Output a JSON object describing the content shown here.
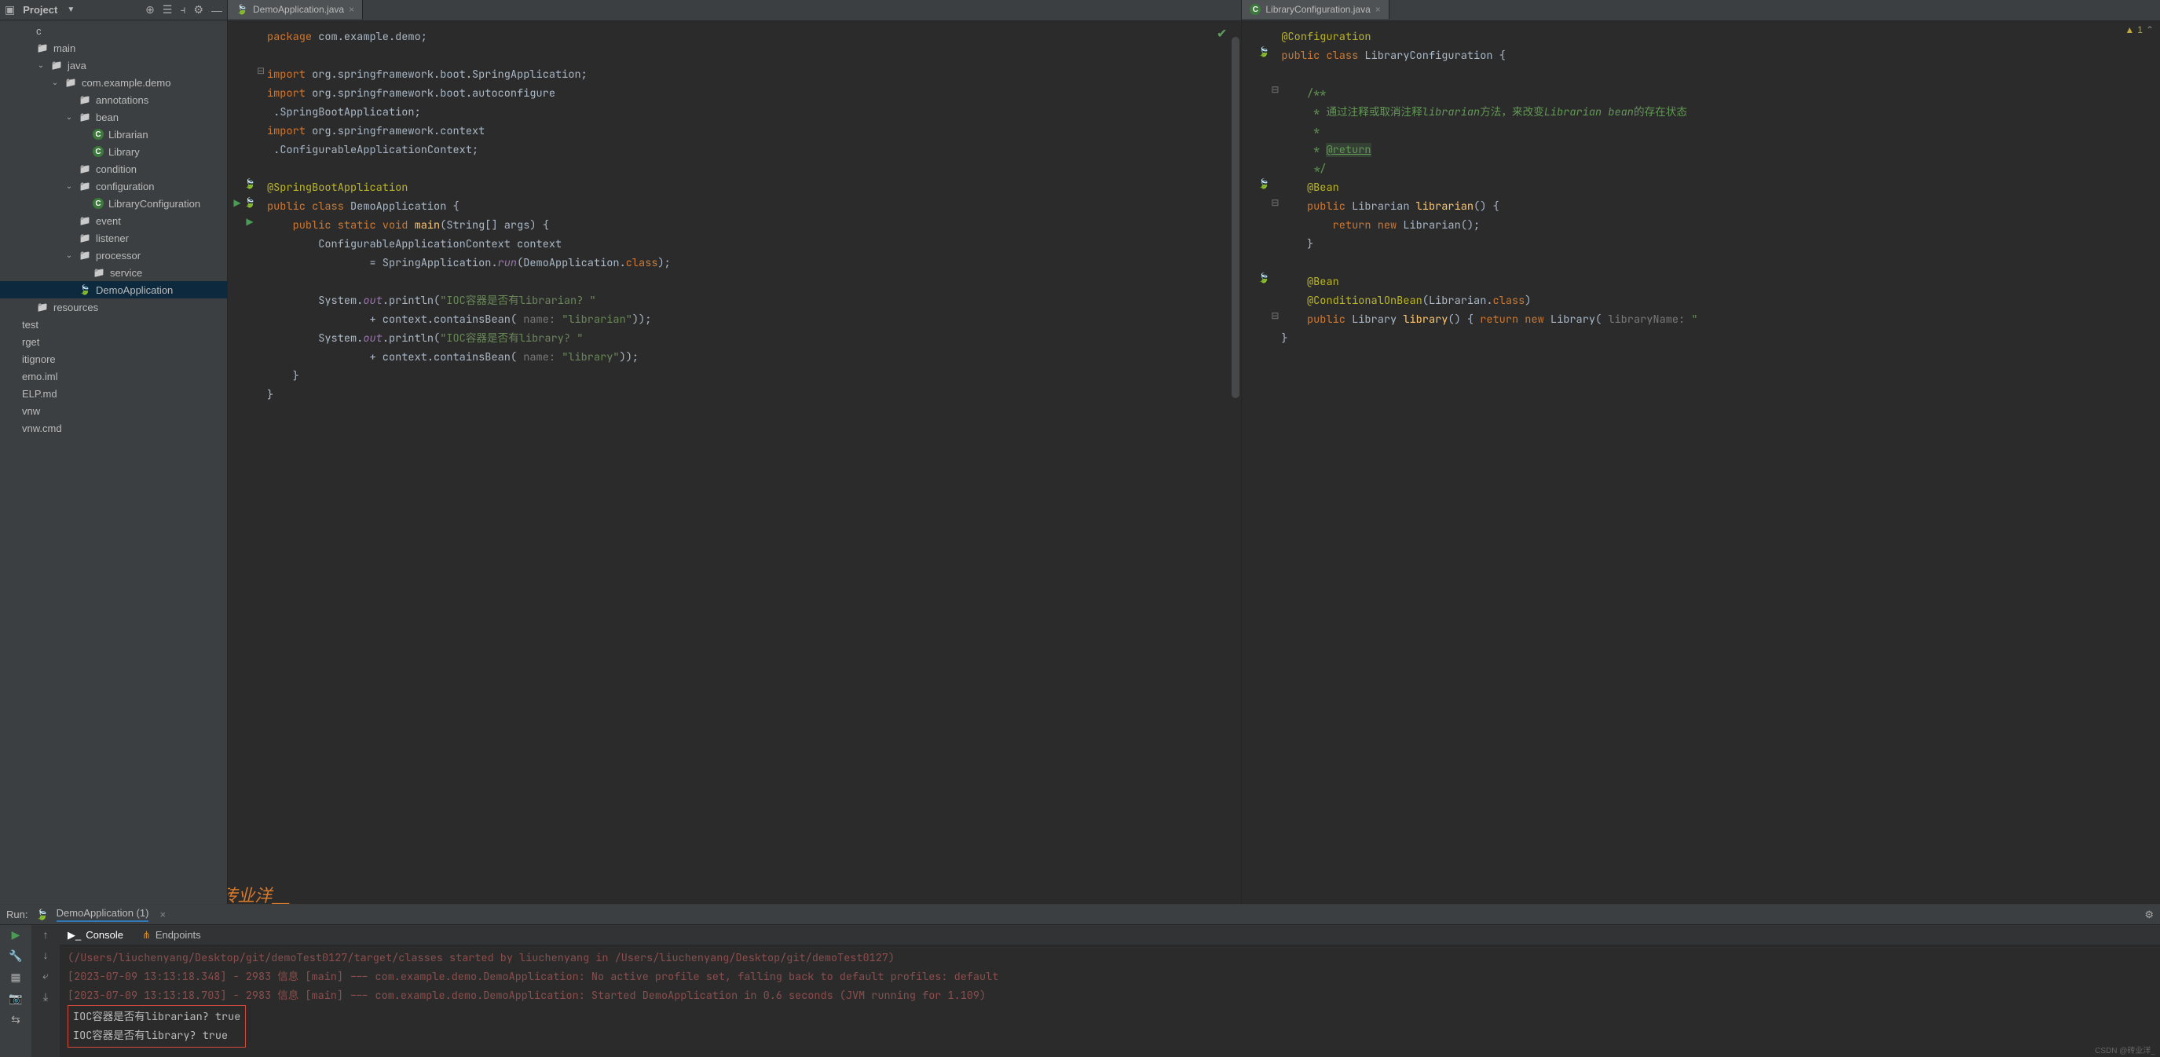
{
  "sidebar": {
    "dropdown_label": "Project",
    "tree": [
      {
        "depth": 0,
        "arrow": "",
        "icon": "",
        "label": "c"
      },
      {
        "depth": 0,
        "arrow": "",
        "icon": "folder",
        "label": "main"
      },
      {
        "depth": 1,
        "arrow": "down",
        "icon": "folder",
        "label": "java",
        "java": true
      },
      {
        "depth": 2,
        "arrow": "down",
        "icon": "pkg",
        "label": "com.example.demo"
      },
      {
        "depth": 3,
        "arrow": "",
        "icon": "pkg",
        "label": "annotations"
      },
      {
        "depth": 3,
        "arrow": "down",
        "icon": "pkg",
        "label": "bean"
      },
      {
        "depth": 4,
        "arrow": "",
        "icon": "class",
        "label": "Librarian"
      },
      {
        "depth": 4,
        "arrow": "",
        "icon": "class",
        "label": "Library"
      },
      {
        "depth": 3,
        "arrow": "",
        "icon": "pkg",
        "label": "condition"
      },
      {
        "depth": 3,
        "arrow": "down",
        "icon": "pkg",
        "label": "configuration"
      },
      {
        "depth": 4,
        "arrow": "",
        "icon": "class",
        "label": "LibraryConfiguration"
      },
      {
        "depth": 3,
        "arrow": "",
        "icon": "pkg",
        "label": "event"
      },
      {
        "depth": 3,
        "arrow": "",
        "icon": "pkg",
        "label": "listener"
      },
      {
        "depth": 3,
        "arrow": "down",
        "icon": "pkg",
        "label": "processor"
      },
      {
        "depth": 4,
        "arrow": "",
        "icon": "pkg",
        "label": "service"
      },
      {
        "depth": 3,
        "arrow": "",
        "icon": "spring",
        "label": "DemoApplication",
        "selected": true
      },
      {
        "depth": 0,
        "arrow": "",
        "icon": "folder",
        "label": "resources"
      },
      {
        "depth": -1,
        "arrow": "",
        "icon": "",
        "label": "test"
      },
      {
        "depth": -1,
        "arrow": "",
        "icon": "",
        "label": "rget"
      },
      {
        "depth": -1,
        "arrow": "",
        "icon": "",
        "label": "itignore"
      },
      {
        "depth": -1,
        "arrow": "",
        "icon": "",
        "label": "emo.iml"
      },
      {
        "depth": -1,
        "arrow": "",
        "icon": "",
        "label": "ELP.md"
      },
      {
        "depth": -1,
        "arrow": "",
        "icon": "",
        "label": "vnw"
      },
      {
        "depth": -1,
        "arrow": "",
        "icon": "",
        "label": "vnw.cmd"
      }
    ]
  },
  "editor1": {
    "tab_label": "DemoApplication.java",
    "code_html": "<span class='kw'>package</span> <span class='pkgpath'>com.example.demo</span>;\n\n<span class='kw'>import</span> <span class='pkgpath'>org.springframework.boot.SpringApplication</span>;\n<span class='kw'>import</span> <span class='pkgpath'>org.springframework.boot.autoconfigure</span>\n .<span class='type'>SpringBootApplication</span>;\n<span class='kw'>import</span> <span class='pkgpath'>org.springframework.context</span>\n .<span class='type'>ConfigurableApplicationContext</span>;\n\n<span class='ann'>@SpringBootApplication</span>\n<span class='kw'>public class</span> <span class='type'>DemoApplication</span> {\n    <span class='kw'>public static void</span> <span class='fn'>main</span>(String[] args) {\n        ConfigurableApplicationContext context\n                = SpringApplication.<span class='field'>run</span>(DemoApplication.<span class='kw'>class</span>);\n\n        System.<span class='field'>out</span>.println(<span class='str'>\"IOC容器是否有librarian? \"</span>\n                + context.containsBean( <span class='hint'>name:</span> <span class='str'>\"librarian\"</span>));\n        System.<span class='field'>out</span>.println(<span class='str'>\"IOC容器是否有library? \"</span>\n                + context.containsBean( <span class='hint'>name:</span> <span class='str'>\"library\"</span>));\n    }\n}\n"
  },
  "editor2": {
    "tab_label": "LibraryConfiguration.java",
    "warning_count": "1",
    "code_html": "<span class='ann'>@Configuration</span>\n<span class='kw'>public class</span> <span class='type'>LibraryConfiguration</span> {\n\n    <span class='cmtdoc'>/**</span>\n    <span class='cmtdoc'> * 通过注释或取消注释<i>librarian</i>方法，来改变<i>Librarian bean</i>的存在状态</span>\n    <span class='cmtdoc'> *</span>\n    <span class='cmtdoc'> * <span class='doctag'>@return</span></span>\n    <span class='cmtdoc'> */</span>\n    <span class='ann'>@Bean</span>\n    <span class='kw'>public</span> Librarian <span class='fn'>librarian</span>() {\n        <span class='kw'>return new</span> Librarian();\n    }\n\n    <span class='ann'>@Bean</span>\n    <span class='ann'>@ConditionalOnBean</span>(Librarian.<span class='kw'>class</span>)\n    <span class='kw'>public</span> Library <span class='fn'>library</span>() { <span class='kw'>return new</span> Library( <span class='hint'>libraryName: </span><span class='str'>\"</span>\n}\n"
  },
  "run": {
    "header_label": "Run:",
    "config_name": "DemoApplication (1)",
    "tabs": {
      "console": "Console",
      "endpoints": "Endpoints"
    },
    "lines": [
      {
        "cls": "log-muted",
        "text": "(/Users/liuchenyang/Desktop/git/demoTest0127/target/classes started by liuchenyang in /Users/liuchenyang/Desktop/git/demoTest0127)"
      },
      {
        "cls": "log-muted",
        "text": "[2023-07-09 13:13:18.348] - 2983 信息 [main] --- com.example.demo.DemoApplication: No active profile set, falling back to default profiles: default"
      },
      {
        "cls": "log-muted",
        "text": "[2023-07-09 13:13:18.703] - 2983 信息 [main] --- com.example.demo.DemoApplication: Started DemoApplication in 0.6 seconds (JVM running for 1.109)"
      },
      {
        "cls": "hilite",
        "text": "IOC容器是否有librarian? true\nIOC容器是否有library? true"
      }
    ]
  },
  "watermark": "@砖业洋__",
  "footer": "CSDN @砖业洋_"
}
